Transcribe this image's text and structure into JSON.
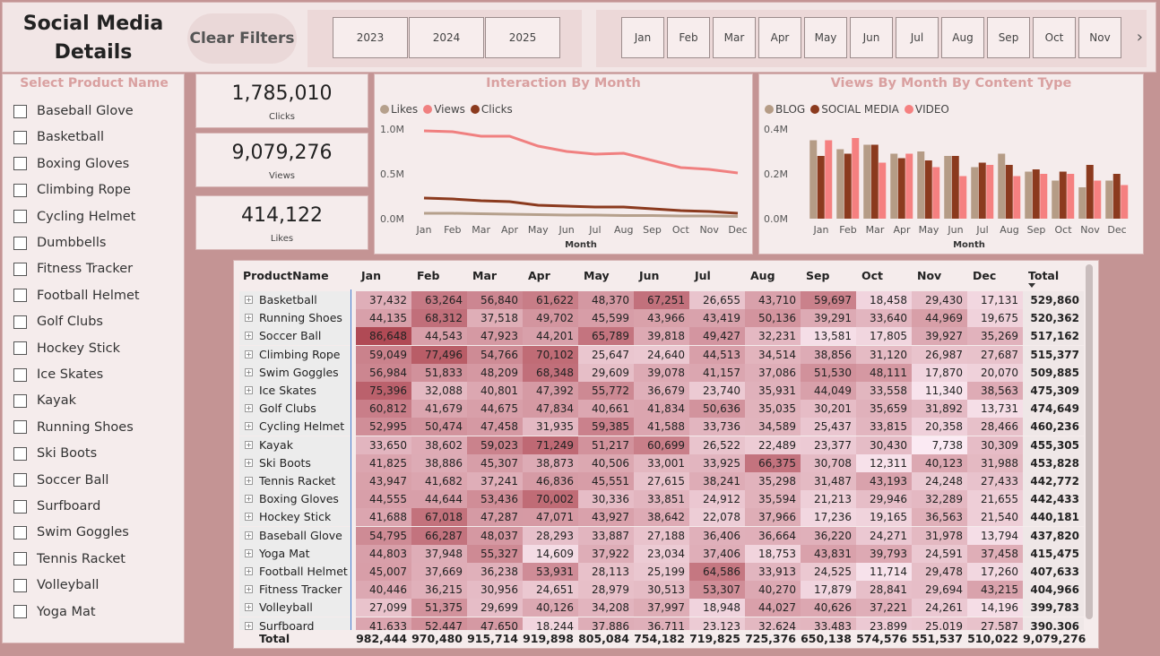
{
  "header": {
    "title": "Social Media Details",
    "clear_filters": "Clear Filters",
    "years": [
      "2023",
      "2024",
      "2025"
    ],
    "months": [
      "Jan",
      "Feb",
      "Mar",
      "Apr",
      "May",
      "Jun",
      "Jul",
      "Aug",
      "Sep",
      "Oct",
      "Nov"
    ]
  },
  "slicer": {
    "title": "Select Product Name",
    "items": [
      "Baseball Glove",
      "Basketball",
      "Boxing Gloves",
      "Climbing Rope",
      "Cycling Helmet",
      "Dumbbells",
      "Fitness Tracker",
      "Football Helmet",
      "Golf Clubs",
      "Hockey Stick",
      "Ice Skates",
      "Kayak",
      "Running Shoes",
      "Ski Boots",
      "Soccer Ball",
      "Surfboard",
      "Swim Goggles",
      "Tennis Racket",
      "Volleyball",
      "Yoga Mat"
    ]
  },
  "kpis": {
    "clicks": {
      "value": "1,785,010",
      "label": "Clicks"
    },
    "views": {
      "value": "9,079,276",
      "label": "Views"
    },
    "likes": {
      "value": "414,122",
      "label": "Likes"
    }
  },
  "colors": {
    "likes": "#b5a08c",
    "views": "#f08080",
    "clicks": "#8b3a1e",
    "blog": "#b59c86",
    "social_media": "#8b3a1e",
    "video": "#f58080",
    "heat_high": "#b04a55",
    "heat_low": "#fbeaf3"
  },
  "chart_data": [
    {
      "type": "line",
      "title": "Interaction By Month",
      "xlabel": "Month",
      "ylabel": "",
      "categories": [
        "Jan",
        "Feb",
        "Mar",
        "Apr",
        "May",
        "Jun",
        "Jul",
        "Aug",
        "Sep",
        "Oct",
        "Nov",
        "Dec"
      ],
      "ylim": [
        0,
        1.0
      ],
      "yticks": [
        "0.0M",
        "0.5M",
        "1.0M"
      ],
      "legend": "top-left",
      "series": [
        {
          "name": "Likes",
          "values": [
            0.06,
            0.06,
            0.055,
            0.05,
            0.045,
            0.04,
            0.04,
            0.035,
            0.035,
            0.03,
            0.03,
            0.025
          ]
        },
        {
          "name": "Views",
          "values": [
            0.98,
            0.97,
            0.92,
            0.92,
            0.81,
            0.75,
            0.72,
            0.73,
            0.65,
            0.57,
            0.55,
            0.51
          ]
        },
        {
          "name": "Clicks",
          "values": [
            0.23,
            0.22,
            0.2,
            0.19,
            0.15,
            0.14,
            0.13,
            0.13,
            0.11,
            0.09,
            0.08,
            0.06
          ]
        }
      ]
    },
    {
      "type": "bar",
      "title": "Views By Month By Content Type",
      "xlabel": "Month",
      "ylabel": "",
      "categories": [
        "Jan",
        "Feb",
        "Mar",
        "Apr",
        "May",
        "Jun",
        "Jul",
        "Aug",
        "Sep",
        "Oct",
        "Nov",
        "Dec"
      ],
      "ylim": [
        0,
        0.4
      ],
      "yticks": [
        "0.0M",
        "0.2M",
        "0.4M"
      ],
      "legend": "top-left",
      "series": [
        {
          "name": "BLOG",
          "values": [
            0.35,
            0.31,
            0.33,
            0.29,
            0.3,
            0.28,
            0.23,
            0.29,
            0.21,
            0.17,
            0.14,
            0.17
          ]
        },
        {
          "name": "SOCIAL MEDIA",
          "values": [
            0.28,
            0.29,
            0.33,
            0.27,
            0.26,
            0.28,
            0.25,
            0.24,
            0.22,
            0.21,
            0.24,
            0.2
          ]
        },
        {
          "name": "VIDEO",
          "values": [
            0.35,
            0.36,
            0.25,
            0.29,
            0.23,
            0.19,
            0.24,
            0.19,
            0.2,
            0.2,
            0.17,
            0.15
          ]
        }
      ]
    },
    {
      "type": "table",
      "columns": [
        "ProductName",
        "Jan",
        "Feb",
        "Mar",
        "Apr",
        "May",
        "Jun",
        "Jul",
        "Aug",
        "Sep",
        "Oct",
        "Nov",
        "Dec",
        "Total"
      ],
      "rows": [
        [
          "Basketball",
          "37,432",
          "63,264",
          "56,840",
          "61,622",
          "48,370",
          "67,251",
          "26,655",
          "43,710",
          "59,697",
          "18,458",
          "29,430",
          "17,131",
          "529,860"
        ],
        [
          "Running Shoes",
          "44,135",
          "68,312",
          "37,518",
          "49,702",
          "45,599",
          "43,966",
          "43,419",
          "50,136",
          "39,291",
          "33,640",
          "44,969",
          "19,675",
          "520,362"
        ],
        [
          "Soccer Ball",
          "86,648",
          "44,543",
          "47,923",
          "44,201",
          "65,789",
          "39,818",
          "49,427",
          "32,231",
          "13,581",
          "17,805",
          "39,927",
          "35,269",
          "517,162"
        ],
        [
          "Climbing Rope",
          "59,049",
          "77,496",
          "54,766",
          "70,102",
          "25,647",
          "24,640",
          "44,513",
          "34,514",
          "38,856",
          "31,120",
          "26,987",
          "27,687",
          "515,377"
        ],
        [
          "Swim Goggles",
          "56,984",
          "51,833",
          "48,209",
          "68,348",
          "29,609",
          "39,078",
          "41,157",
          "37,086",
          "51,530",
          "48,111",
          "17,870",
          "20,070",
          "509,885"
        ],
        [
          "Ice Skates",
          "75,396",
          "32,088",
          "40,801",
          "47,392",
          "55,772",
          "36,679",
          "23,740",
          "35,931",
          "44,049",
          "33,558",
          "11,340",
          "38,563",
          "475,309"
        ],
        [
          "Golf Clubs",
          "60,812",
          "41,679",
          "44,675",
          "47,834",
          "40,661",
          "41,834",
          "50,636",
          "35,035",
          "30,201",
          "35,659",
          "31,892",
          "13,731",
          "474,649"
        ],
        [
          "Cycling Helmet",
          "52,995",
          "50,474",
          "47,458",
          "31,935",
          "59,385",
          "41,588",
          "33,736",
          "34,589",
          "25,437",
          "33,815",
          "20,358",
          "28,466",
          "460,236"
        ],
        [
          "Kayak",
          "33,650",
          "38,602",
          "59,023",
          "71,249",
          "51,217",
          "60,699",
          "26,522",
          "22,489",
          "23,377",
          "30,430",
          "7,738",
          "30,309",
          "455,305"
        ],
        [
          "Ski Boots",
          "41,825",
          "38,886",
          "45,307",
          "38,873",
          "40,506",
          "33,001",
          "33,925",
          "66,375",
          "30,708",
          "12,311",
          "40,123",
          "31,988",
          "453,828"
        ],
        [
          "Tennis Racket",
          "43,947",
          "41,682",
          "37,241",
          "46,836",
          "45,551",
          "27,615",
          "38,241",
          "35,298",
          "31,487",
          "43,193",
          "24,248",
          "27,433",
          "442,772"
        ],
        [
          "Boxing Gloves",
          "44,555",
          "44,644",
          "53,436",
          "70,002",
          "30,336",
          "33,851",
          "24,912",
          "35,594",
          "21,213",
          "29,946",
          "32,289",
          "21,655",
          "442,433"
        ],
        [
          "Hockey Stick",
          "41,688",
          "67,018",
          "47,287",
          "47,071",
          "43,927",
          "38,642",
          "22,078",
          "37,966",
          "17,236",
          "19,165",
          "36,563",
          "21,540",
          "440,181"
        ],
        [
          "Baseball Glove",
          "54,795",
          "66,287",
          "48,037",
          "28,293",
          "33,887",
          "27,188",
          "36,406",
          "36,664",
          "36,220",
          "24,271",
          "31,978",
          "13,794",
          "437,820"
        ],
        [
          "Yoga Mat",
          "44,803",
          "37,948",
          "55,327",
          "14,609",
          "37,922",
          "23,034",
          "37,406",
          "18,753",
          "43,831",
          "39,793",
          "24,591",
          "37,458",
          "415,475"
        ],
        [
          "Football Helmet",
          "45,007",
          "37,669",
          "36,238",
          "53,931",
          "28,113",
          "25,199",
          "64,586",
          "33,913",
          "24,525",
          "11,714",
          "29,478",
          "17,260",
          "407,633"
        ],
        [
          "Fitness Tracker",
          "40,446",
          "36,215",
          "30,956",
          "24,651",
          "28,979",
          "30,513",
          "53,307",
          "40,270",
          "17,879",
          "28,841",
          "29,694",
          "43,215",
          "404,966"
        ],
        [
          "Volleyball",
          "27,099",
          "51,375",
          "29,699",
          "40,126",
          "34,208",
          "37,997",
          "18,948",
          "44,027",
          "40,626",
          "37,221",
          "24,261",
          "14,196",
          "399,783"
        ],
        [
          "Surfboard",
          "41,633",
          "52,447",
          "47,650",
          "18,244",
          "37,886",
          "36,711",
          "23,123",
          "32,624",
          "33,483",
          "23,899",
          "25,019",
          "27,587",
          "390,306"
        ]
      ],
      "total": [
        "Total",
        "982,444",
        "970,480",
        "915,714",
        "919,898",
        "805,084",
        "754,182",
        "719,825",
        "725,376",
        "650,138",
        "574,576",
        "551,537",
        "510,022",
        "9,079,276"
      ]
    }
  ]
}
